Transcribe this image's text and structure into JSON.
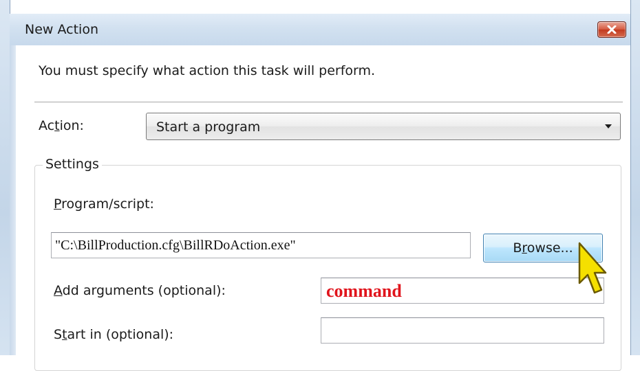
{
  "window": {
    "title": "New Action"
  },
  "dialog": {
    "instruction": "You must specify what action this task will perform.",
    "action_label": "Action:",
    "action_value": "Start a program",
    "settings_legend": "Settings",
    "program_label": "Program/script:",
    "program_value": "\"C:\\BillProduction.cfg\\BillRDoAction.exe\"",
    "browse_label": "Browse...",
    "arguments_label": "Add arguments (optional):",
    "arguments_value": "command",
    "start_in_label": "Start in (optional):",
    "start_in_value": ""
  },
  "colors": {
    "annotation_red": "#e0141c",
    "cursor_yellow": "#f5e000"
  },
  "icons": {
    "close": "close-icon",
    "dropdown": "chevron-down-icon",
    "cursor": "mouse-pointer-icon"
  }
}
